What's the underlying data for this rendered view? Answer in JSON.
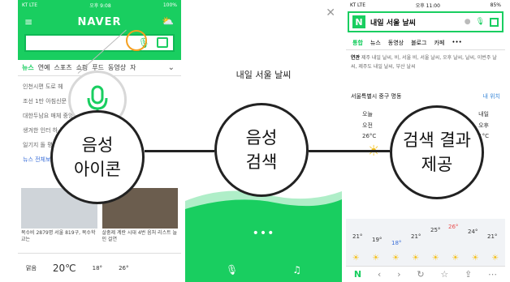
{
  "panel1": {
    "status": {
      "carrier": "KT LTE",
      "time": "오후 9:08",
      "battery": "100%"
    },
    "brand": "NAVER",
    "tabs": [
      "뉴스",
      "연예",
      "스포츠",
      "쇼핑",
      "푸드",
      "동영상",
      "자"
    ],
    "news": [
      "인천시편 도로 헤",
      "조선 1만 아침신문",
      "대한두남요 매체 중앙경제위원",
      "생겨한 인터 하 종합뉴원",
      "일기지 돌 평자격 예전",
      "뉴스 전체보기"
    ],
    "thumb1_caption": "목수비 2879명 서울 819구, 목수학교는",
    "thumb2_caption": "살충제 계란 시대 4번 음처 리스트 늘인 걸연",
    "weather": {
      "label": "맑음",
      "temp": "20℃",
      "f1": "18°",
      "f2": "26°"
    }
  },
  "panel2": {
    "query": "내일 서울 날씨",
    "dots": "•••"
  },
  "panel3": {
    "status": {
      "carrier": "KT LTE",
      "time": "오후 11:00",
      "battery": "85%"
    },
    "query": "내일 서울 날씨",
    "tabs": [
      "통합",
      "뉴스",
      "동영상",
      "블로그",
      "카페",
      "•••"
    ],
    "related_label": "연관",
    "related": "제주 내일 날씨, 비, 서울 비, 서울 날씨, 오후 날씨, 날씨, 이번주 날씨, 제주도 내일 날씨, 부산 날씨",
    "wtitle": "서울특별시 중구 명동",
    "wtitle_right": "내 위치",
    "forecast": [
      [
        "오늘",
        "내일"
      ],
      [
        "오전",
        "오후"
      ],
      [
        "26°C",
        "21°C"
      ]
    ],
    "graph_temps": [
      "21°",
      "19°",
      "18°",
      "21°",
      "25°",
      "26°",
      "24°",
      "21°"
    ],
    "icons": [
      "☀",
      "☀",
      "☀",
      "☀",
      "☀",
      "☀",
      "☀",
      "☀"
    ]
  },
  "labels": {
    "c1_l1": "음성",
    "c1_l2": "아이콘",
    "c2_l1": "음성",
    "c2_l2": "검색",
    "c3_l1": "검색 결과",
    "c3_l2": "제공"
  },
  "colors": {
    "naver_green": "#19ce60",
    "accent_orange": "#f4a020"
  }
}
